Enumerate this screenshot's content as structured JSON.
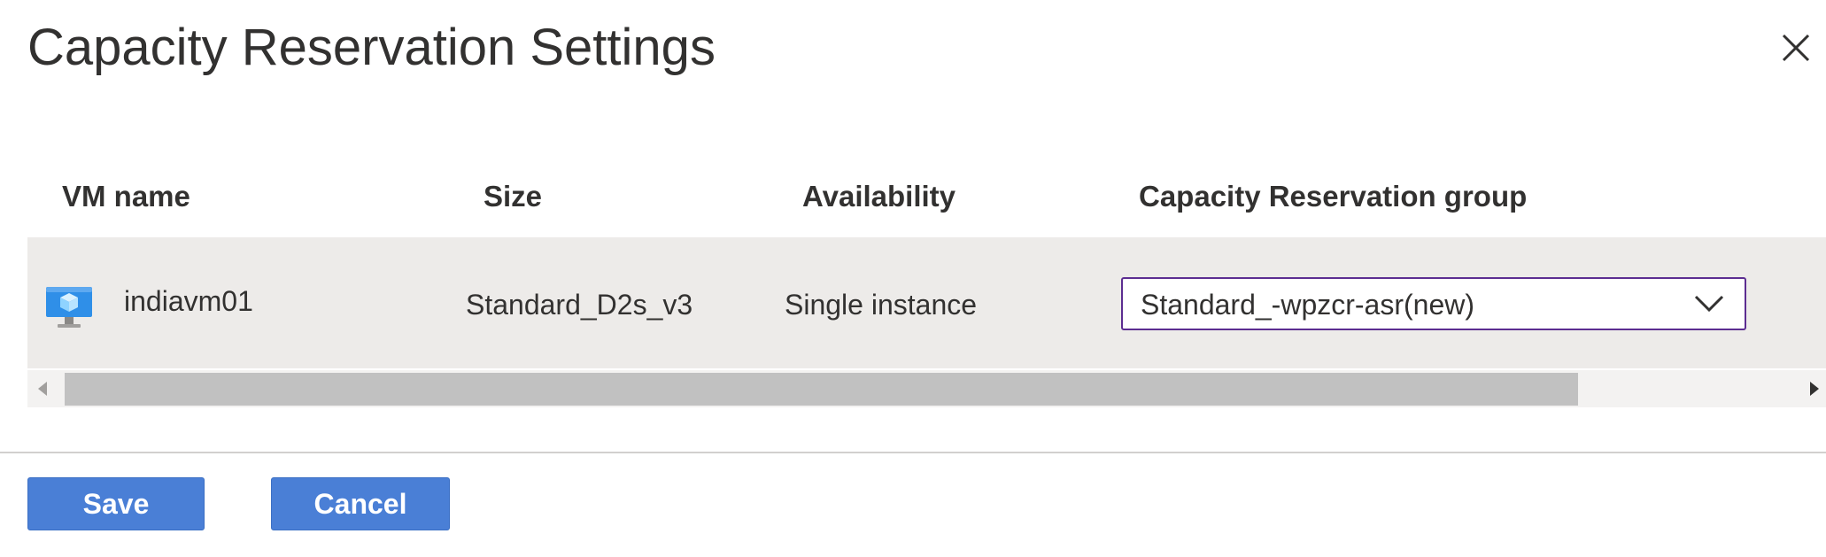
{
  "dialog": {
    "title": "Capacity Reservation Settings",
    "close_icon": "close-icon"
  },
  "table": {
    "columns": [
      "VM name",
      "Size",
      "Availability",
      "Capacity Reservation group"
    ],
    "rows": [
      {
        "icon": "virtual-machine-icon",
        "vm_name": "indiavm01",
        "size": "Standard_D2s_v3",
        "availability": "Single instance",
        "capacity_reservation_group": "Standard_-wpzcr-asr(new)"
      }
    ]
  },
  "footer": {
    "save_label": "Save",
    "cancel_label": "Cancel"
  },
  "colors": {
    "accent_button": "#4a7fd6",
    "select_border": "#5c2d91",
    "row_background": "#edebe9"
  }
}
